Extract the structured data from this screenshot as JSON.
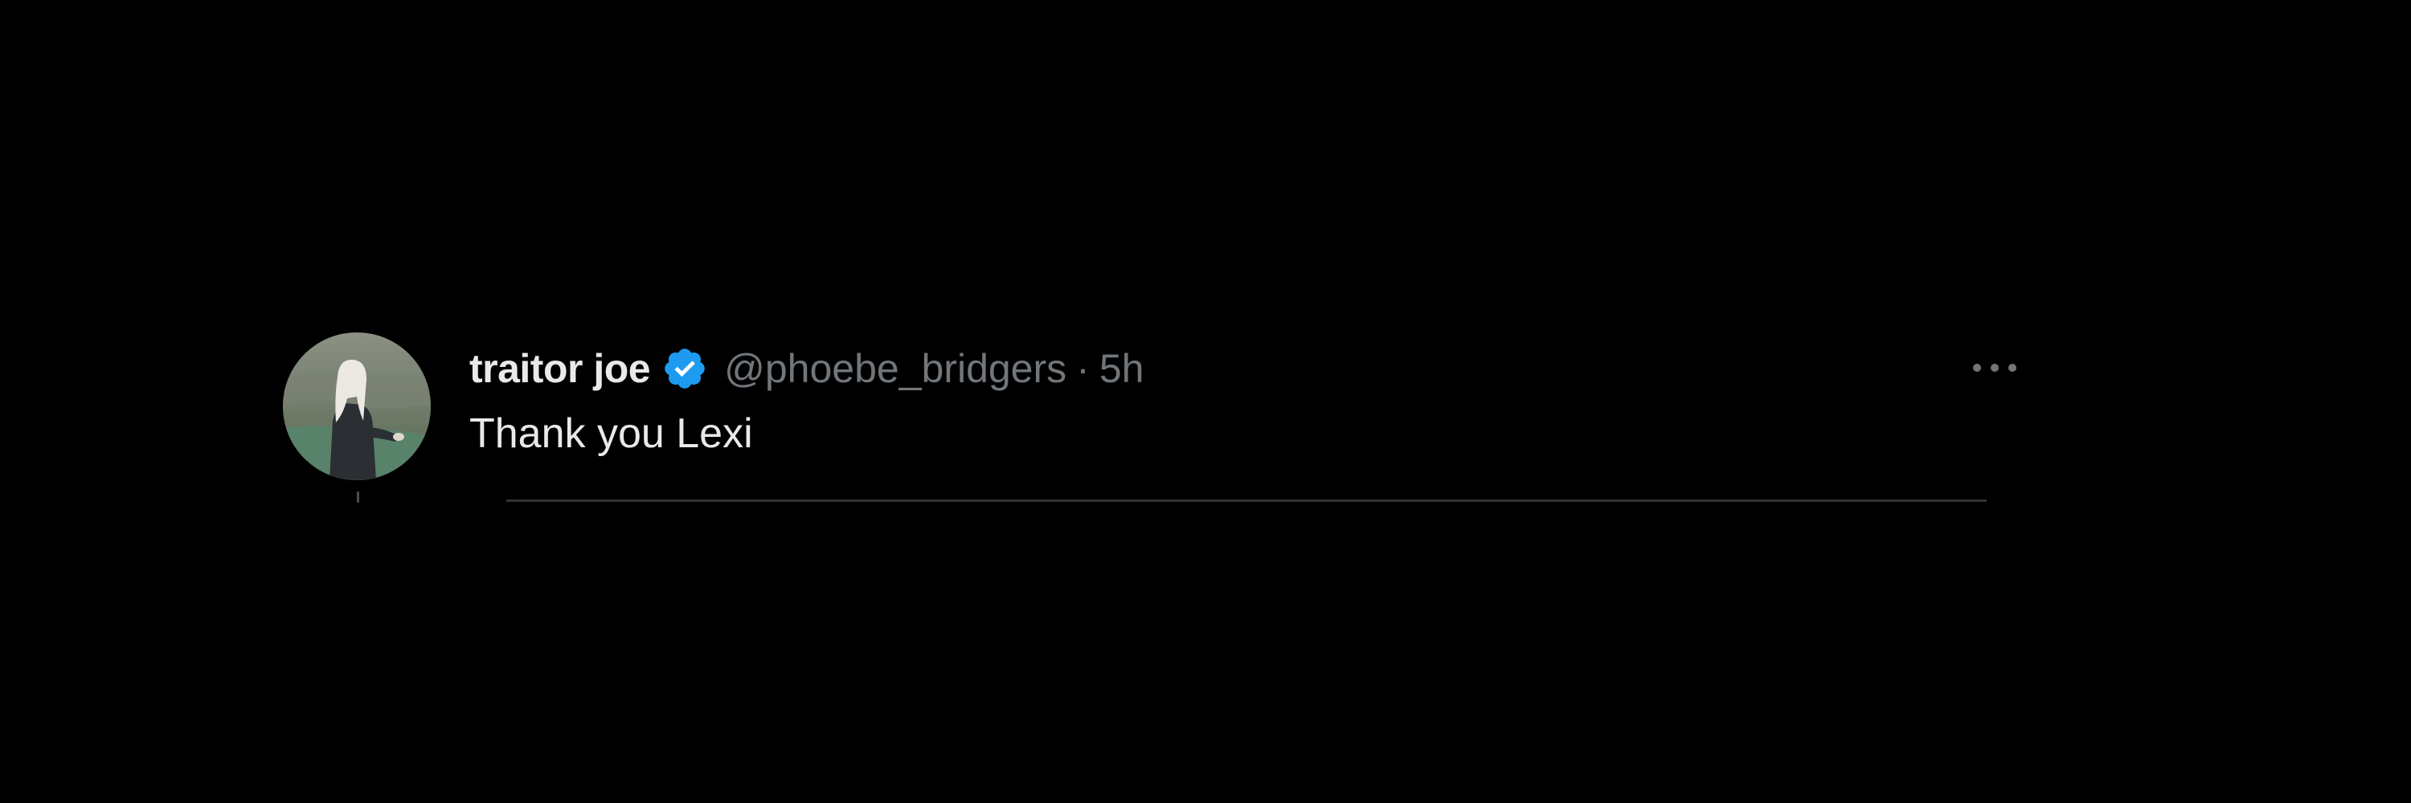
{
  "tweet": {
    "display_name": "traitor joe",
    "handle": "@phoebe_bridgers",
    "separator": "·",
    "timestamp": "5h",
    "text": "Thank you Lexi"
  },
  "icons": {
    "verified": "verified-badge-icon",
    "more": "more-options-icon"
  },
  "colors": {
    "background": "#000000",
    "primary_text": "#e7e9ea",
    "secondary_text": "#71767b",
    "verified_blue": "#1d9bf0",
    "divider": "#2f3336"
  }
}
